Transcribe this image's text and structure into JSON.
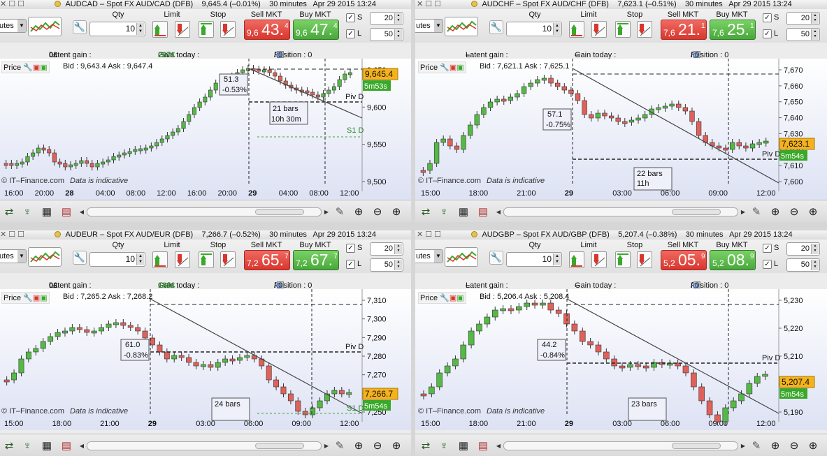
{
  "panels": [
    {
      "id": "audcad",
      "title": "AUDCAD – Spot FX AUD/CAD (DFB)",
      "quote": "9,645.4 (–0.01%)",
      "interval": "30 minutes",
      "date": "Apr 29 2015 13:24",
      "timeframe": "utes",
      "qty": "10",
      "sell": {
        "small": "9,6",
        "big": "43.",
        "sup": "4"
      },
      "buy": {
        "small": "9,6",
        "big": "47.",
        "sup": "4"
      },
      "s_value": "20",
      "l_value": "50",
      "latent_label": "Latent gain : ",
      "latent_value": "0£",
      "today_label": "Gain today : ",
      "today_value": "297£",
      "position_label": "Position : 0",
      "position_extra": "/  0",
      "bidask": "Bid : 9,643.4 Ask : 9,647.4",
      "annotations": [
        "51.3",
        "-0.53%",
        "21 bars",
        "10h 30m",
        "Piv D",
        "S1 D"
      ],
      "last_price": "9,645.4",
      "countdown": "5m53s",
      "axis_y": [
        "9,650",
        "9,600",
        "9,550",
        "9,500"
      ],
      "axis_x": [
        "16:00",
        "20:00",
        "28",
        "04:00",
        "08:00",
        "12:00",
        "16:00",
        "20:00",
        "29",
        "04:00",
        "08:00",
        "12:00"
      ]
    },
    {
      "id": "audchf",
      "title": "AUDCHF – Spot FX AUD/CHF (DFB)",
      "quote": "7,623.1 (–0.51%)",
      "interval": "30 minutes",
      "date": "Apr 29 2015 13:24",
      "timeframe": "utes",
      "qty": "10",
      "sell": {
        "small": "7,6",
        "big": "21.",
        "sup": "1"
      },
      "buy": {
        "small": "7,6",
        "big": "25.",
        "sup": "1"
      },
      "s_value": "20",
      "l_value": "50",
      "latent_label": "Latent gain : ",
      "latent_value": "–",
      "today_label": "Gain today : ",
      "today_value": "–",
      "position_label": "Position : 0",
      "position_extra": "/  0",
      "bidask": "Bid : 7,621.1 Ask : 7,625.1",
      "annotations": [
        "57.1",
        "-0.75%",
        "22 bars",
        "11h",
        "Piv D"
      ],
      "last_price": "7,623.1",
      "countdown": "5m54s",
      "axis_y": [
        "7,670",
        "7,660",
        "7,650",
        "7,640",
        "7,630",
        "7,620",
        "7,610",
        "7,600"
      ],
      "axis_x": [
        "15:00",
        "18:00",
        "21:00",
        "29",
        "03:00",
        "06:00",
        "09:00",
        "12:00"
      ]
    },
    {
      "id": "audeur",
      "title": "AUDEUR – Spot FX AUD/EUR (DFB)",
      "quote": "7,266.7 (–0.52%)",
      "interval": "30 minutes",
      "date": "Apr 29 2015 13:24",
      "timeframe": "utes",
      "qty": "10",
      "sell": {
        "small": "7,2",
        "big": "65.",
        "sup": "7"
      },
      "buy": {
        "small": "7,2",
        "big": "67.",
        "sup": "7"
      },
      "s_value": "20",
      "l_value": "50",
      "latent_label": "Latent gain : ",
      "latent_value": "0£",
      "today_label": "Gain today : ",
      "today_value": "189£",
      "position_label": "Position : 0",
      "position_extra": "/  0",
      "bidask": "Bid : 7,265.2 Ask : 7,268.2",
      "annotations": [
        "61.0",
        "-0.83%",
        "24 bars",
        "Piv D",
        "S1 D"
      ],
      "last_price": "7,266.7",
      "countdown": "5m54s",
      "axis_y": [
        "7,310",
        "7,300",
        "7,290",
        "7,280",
        "7,270",
        "7,260",
        "7,250"
      ],
      "axis_x": [
        "15:00",
        "18:00",
        "21:00",
        "29",
        "03:00",
        "06:00",
        "09:00",
        "12:00"
      ]
    },
    {
      "id": "audgbp",
      "title": "AUDGBP – Spot FX AUD/GBP (DFB)",
      "quote": "5,207.4 (–0.38%)",
      "interval": "30 minutes",
      "date": "Apr 29 2015 13:24",
      "timeframe": "utes",
      "qty": "10",
      "sell": {
        "small": "5,2",
        "big": "05.",
        "sup": "9"
      },
      "buy": {
        "small": "5,2",
        "big": "08.",
        "sup": "9"
      },
      "s_value": "20",
      "l_value": "50",
      "latent_label": "Latent gain : ",
      "latent_value": "–",
      "today_label": "Gain today : ",
      "today_value": "–",
      "position_label": "Position : 0",
      "position_extra": "/  0",
      "bidask": "Bid : 5,206.4 Ask : 5,208.4",
      "annotations": [
        "44.2",
        "-0.84%",
        "23 bars",
        "Piv D"
      ],
      "last_price": "5,207.4",
      "countdown": "5m54s",
      "axis_y": [
        "5,230",
        "5,220",
        "5,210",
        "5,200",
        "5,190"
      ],
      "axis_x": [
        "15:00",
        "18:00",
        "21:00",
        "29",
        "03:00",
        "06:00",
        "09:00",
        "12:00"
      ]
    }
  ],
  "labels": {
    "qty": "Qty",
    "limit": "Limit",
    "stop": "Stop",
    "sell_mkt": "Sell MKT",
    "buy_mkt": "Buy MKT",
    "s": "S",
    "l": "L",
    "price": "Price",
    "watermark_brand": "© IT–Finance.com",
    "watermark_note": "Data is indicative"
  },
  "colors": {
    "up_candle": "#55b847",
    "down_candle": "#e0605a",
    "sell": "#d8362d",
    "buy": "#48a83a",
    "last_price_tag": "#f5b21c",
    "countdown_tag": "#3aa82a"
  }
}
